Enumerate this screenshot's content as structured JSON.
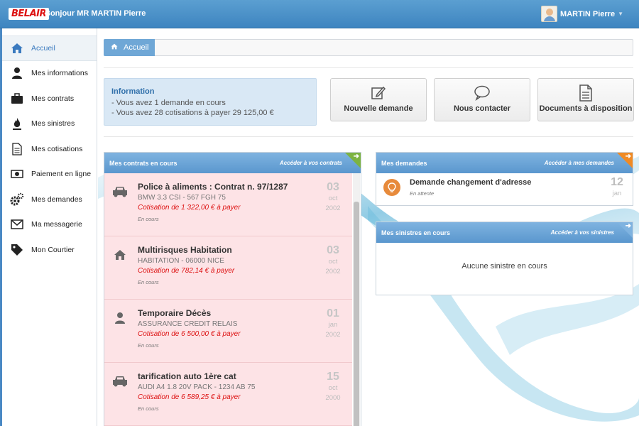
{
  "header": {
    "logo_text": "BELAIR",
    "greeting": "Bonjour MR MARTIN Pierre",
    "user_name": "MARTIN Pierre",
    "brand_color": "#3e85c0"
  },
  "sidebar": {
    "items": [
      {
        "label": "Accueil",
        "icon": "home-icon",
        "active": true
      },
      {
        "label": "Mes informations",
        "icon": "user-icon"
      },
      {
        "label": "Mes contrats",
        "icon": "briefcase-icon"
      },
      {
        "label": "Mes sinistres",
        "icon": "fire-icon"
      },
      {
        "label": "Mes cotisations",
        "icon": "document-icon"
      },
      {
        "label": "Paiement en ligne",
        "icon": "banknote-icon"
      },
      {
        "label": "Mes demandes",
        "icon": "gears-icon"
      },
      {
        "label": "Ma messagerie",
        "icon": "envelope-icon"
      },
      {
        "label": "Mon Courtier",
        "icon": "tag-icon"
      }
    ]
  },
  "breadcrumb": {
    "label": "Accueil"
  },
  "info": {
    "title": "Information",
    "line1": "- Vous avez 1 demande en cours",
    "line2": "- Vous avez 28 cotisations à payer 29 125,00 €"
  },
  "tiles": [
    {
      "label": "Nouvelle demande",
      "icon": "edit-icon"
    },
    {
      "label": "Nous contacter",
      "icon": "chat-bubble-icon"
    },
    {
      "label": "Documents à disposition",
      "icon": "file-text-icon"
    }
  ],
  "contracts_panel": {
    "title": "Mes contrats en cours",
    "link": "Accéder à vos contrats",
    "items": [
      {
        "title": "Police à aliments : Contrat n. 97/1287",
        "sub": "BMW 3.3 CSI - 567 FGH 75",
        "cotisation": "Cotisation de 1 322,00 € à payer",
        "status": "En cours",
        "day": "03",
        "month": "oct",
        "year": "2002",
        "icon": "car-icon"
      },
      {
        "title": "Multirisques Habitation",
        "sub": "HABITATION - 06000 NICE",
        "cotisation": "Cotisation de 782,14 € à payer",
        "status": "En cours",
        "day": "03",
        "month": "oct",
        "year": "2002",
        "icon": "home-icon"
      },
      {
        "title": "Temporaire Décès",
        "sub": "ASSURANCE CREDIT RELAIS",
        "cotisation": "Cotisation de 6 500,00 € à payer",
        "status": "En cours",
        "day": "01",
        "month": "jan",
        "year": "2002",
        "icon": "user-icon"
      },
      {
        "title": "tarification auto 1ère cat",
        "sub": "AUDI A4 1.8 20V PACK - 1234 AB 75",
        "cotisation": "Cotisation de 6 589,25 € à payer",
        "status": "En cours",
        "day": "15",
        "month": "oct",
        "year": "2000",
        "icon": "car-icon"
      }
    ]
  },
  "requests_panel": {
    "title": "Mes demandes",
    "link": "Accéder à mes demandes",
    "items": [
      {
        "title": "Demande changement d'adresse",
        "status": "En attente",
        "day": "12",
        "month": "jan",
        "icon": "lightbulb-icon"
      }
    ]
  },
  "claims_panel": {
    "title": "Mes sinistres en cours",
    "link": "Accéder à vos sinistres",
    "empty_text": "Aucune sinistre en cours"
  }
}
